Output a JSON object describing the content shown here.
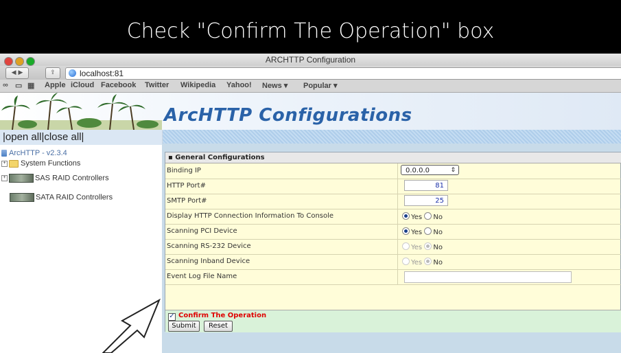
{
  "caption": "Check \"Confirm The Operation\" box",
  "window": {
    "title": "ARCHTTP Configuration"
  },
  "address_bar": {
    "url": "localhost:81"
  },
  "bookmarks": [
    "Apple",
    "iCloud",
    "Facebook",
    "Twitter",
    "Wikipedia",
    "Yahoo!",
    "News ▾",
    "Popular ▾"
  ],
  "app": {
    "title": "ArcHTTP Configurations"
  },
  "sidebar": {
    "open_close": "|open all|close all|",
    "items": [
      {
        "label": "ArcHTTP - v2.3.4"
      },
      {
        "label": "System Functions"
      },
      {
        "label": "SAS RAID Controllers"
      },
      {
        "label": "SATA RAID Controllers"
      }
    ]
  },
  "form": {
    "section_title": "General Configurations",
    "fields": {
      "binding_ip": {
        "label": "Binding IP",
        "value": "0.0.0.0"
      },
      "http_port": {
        "label": "HTTP Port#",
        "value": "81"
      },
      "smtp_port": {
        "label": "SMTP Port#",
        "value": "25"
      },
      "display_http": {
        "label": "Display HTTP Connection Information To Console",
        "yes": "Yes",
        "no": "No",
        "selected": "Yes"
      },
      "scan_pci": {
        "label": "Scanning PCI Device",
        "yes": "Yes",
        "no": "No",
        "selected": "Yes"
      },
      "scan_rs232": {
        "label": "Scanning RS-232 Device",
        "yes": "Yes",
        "no": "No",
        "selected": "No"
      },
      "scan_inband": {
        "label": "Scanning Inband Device",
        "yes": "Yes",
        "no": "No",
        "selected": "No"
      },
      "event_log": {
        "label": "Event Log File Name",
        "value": ""
      }
    },
    "confirm_label": "Confirm The Operation",
    "confirm_checked": true,
    "submit_label": "Submit",
    "reset_label": "Reset"
  },
  "colors": {
    "accent": "#2a62a8",
    "confirm_text": "#e00000",
    "panel_bg": "#fffdd9",
    "confirm_bg": "#d9f2d9"
  }
}
